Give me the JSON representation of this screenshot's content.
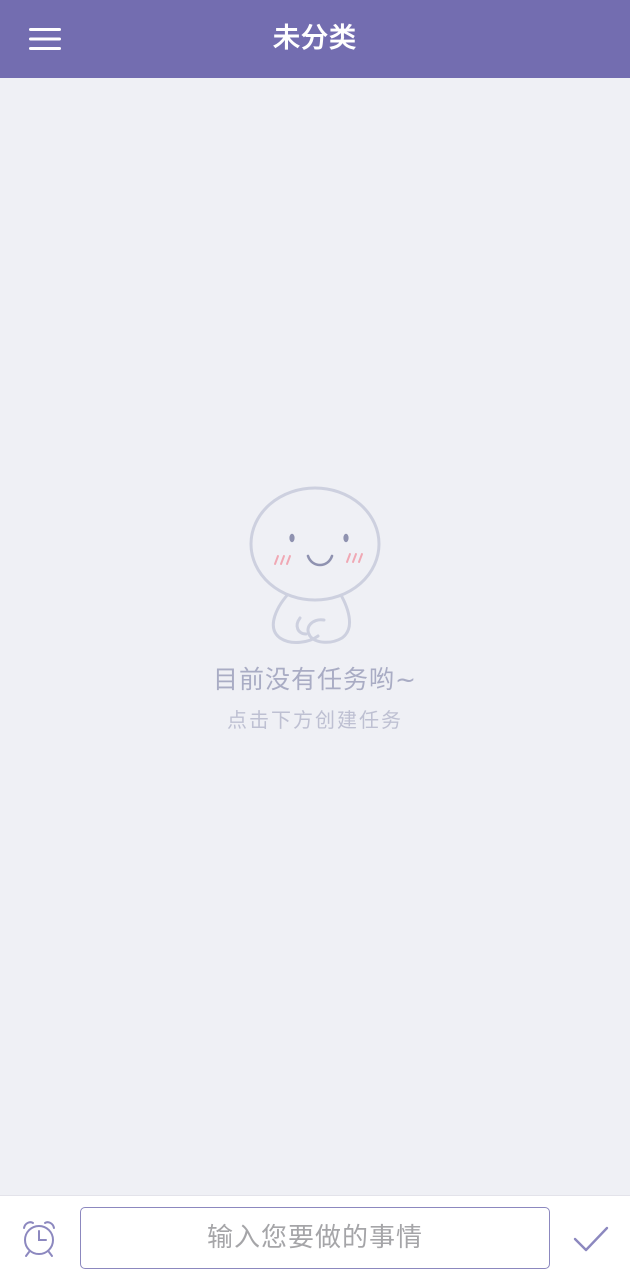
{
  "header": {
    "title": "未分类",
    "menu_icon": "hamburger-menu-icon",
    "background_color": "#736db0"
  },
  "empty_state": {
    "illustration": "smiling-ghost-illustration",
    "title": "目前没有任务哟~",
    "subtitle": "点击下方创建任务"
  },
  "bottom_bar": {
    "reminder_icon": "alarm-clock-icon",
    "input": {
      "value": "",
      "placeholder": "输入您要做的事情"
    },
    "confirm_icon": "checkmark-icon",
    "accent_color": "#8c88bf"
  }
}
